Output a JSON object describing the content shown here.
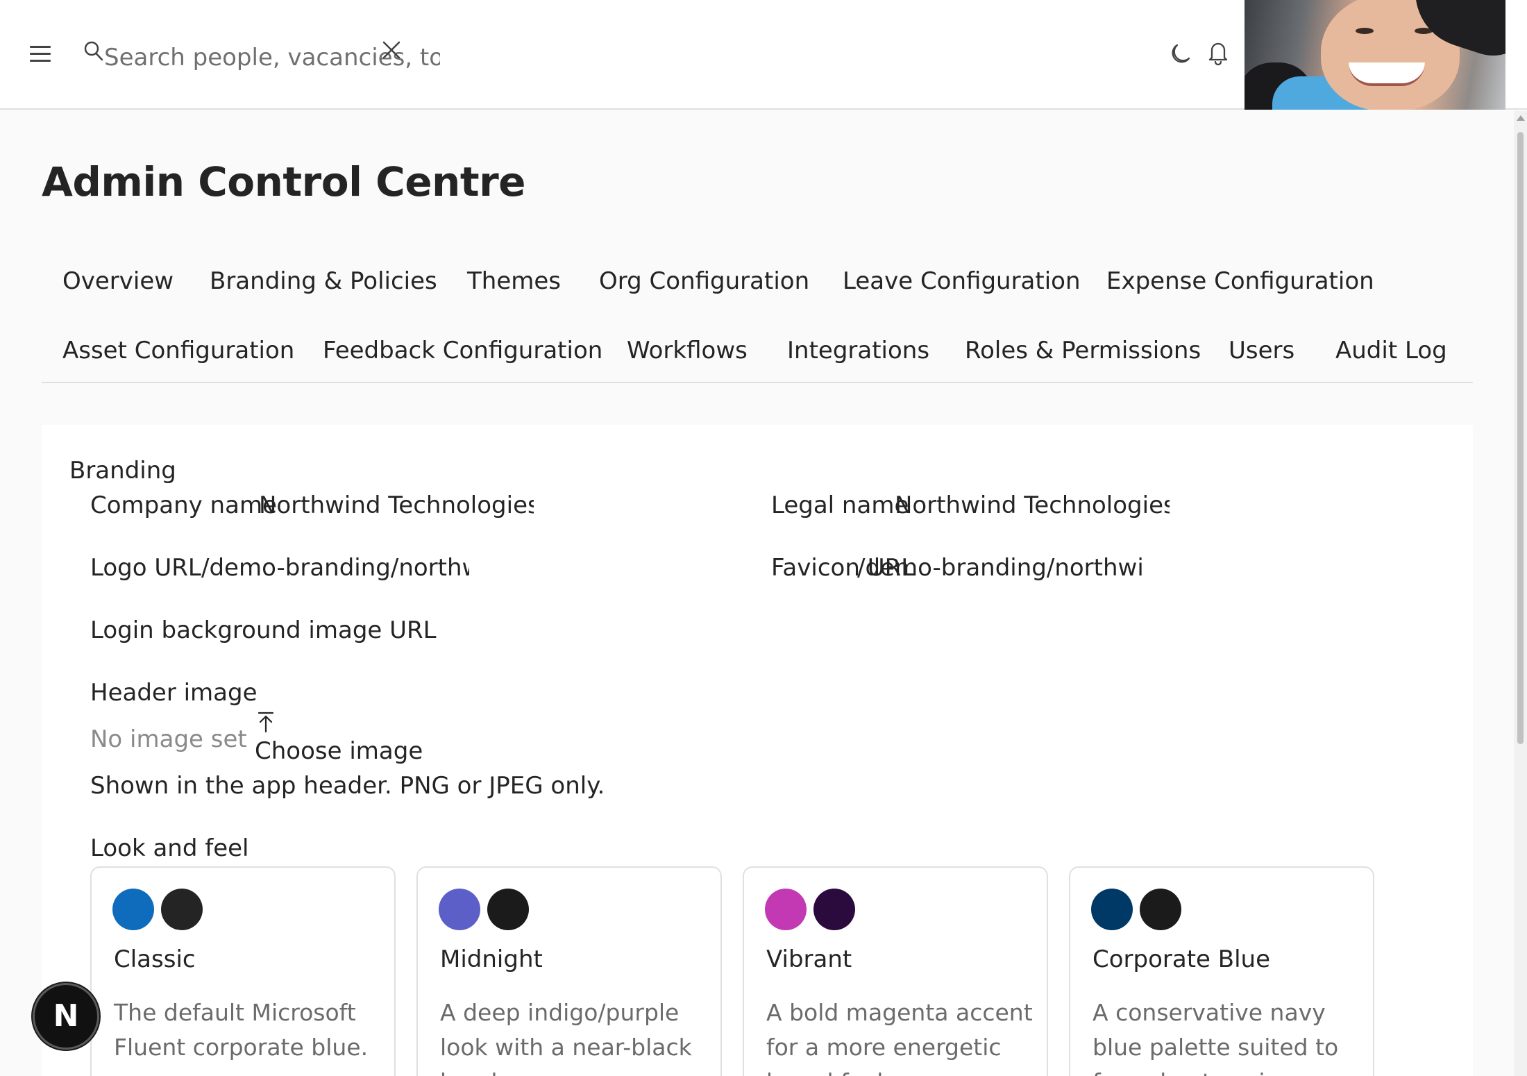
{
  "header": {
    "search_placeholder": "Search people, vacancies, tools"
  },
  "page": {
    "title": "Admin Control Centre"
  },
  "tabs": [
    "Overview",
    "Branding & Policies",
    "Themes",
    "Org Configuration",
    "Leave Configuration",
    "Expense Configuration",
    "Asset Configuration",
    "Feedback Configuration",
    "Workflows",
    "Integrations",
    "Roles & Permissions",
    "Users",
    "Audit Log"
  ],
  "branding": {
    "section_title": "Branding",
    "company_name_label": "Company name",
    "company_name_value": "Northwind Technologies L",
    "legal_name_label": "Legal name",
    "legal_name_value": "Northwind Technologies L",
    "logo_url_label": "Logo URL",
    "logo_url_value": "/demo-branding/northwi",
    "favicon_url_label": "Favicon URL",
    "favicon_url_value": "/demo-branding/northwi",
    "login_bg_label": "Login background image URL",
    "header_image_label": "Header image",
    "no_image_text": "No image set",
    "choose_image_label": "Choose image",
    "header_image_help": "Shown in the app header. PNG or JPEG only.",
    "look_and_feel_label": "Look and feel"
  },
  "themes": [
    {
      "name": "Classic",
      "description": "The default Microsoft Fluent corporate blue.",
      "primary": "#0f6cbd",
      "secondary": "#242424"
    },
    {
      "name": "Midnight",
      "description": "A deep indigo/purple look with a near-black header.",
      "primary": "#5b5fc7",
      "secondary": "#1b1b1b"
    },
    {
      "name": "Vibrant",
      "description": "A bold magenta accent for a more energetic brand feel.",
      "primary": "#c239b3",
      "secondary": "#2b0a3d"
    },
    {
      "name": "Corporate Blue",
      "description": "A conservative navy blue palette suited to formal enterprises.",
      "primary": "#003966",
      "secondary": "#1b1b1b"
    }
  ],
  "badge": {
    "letter": "N"
  }
}
